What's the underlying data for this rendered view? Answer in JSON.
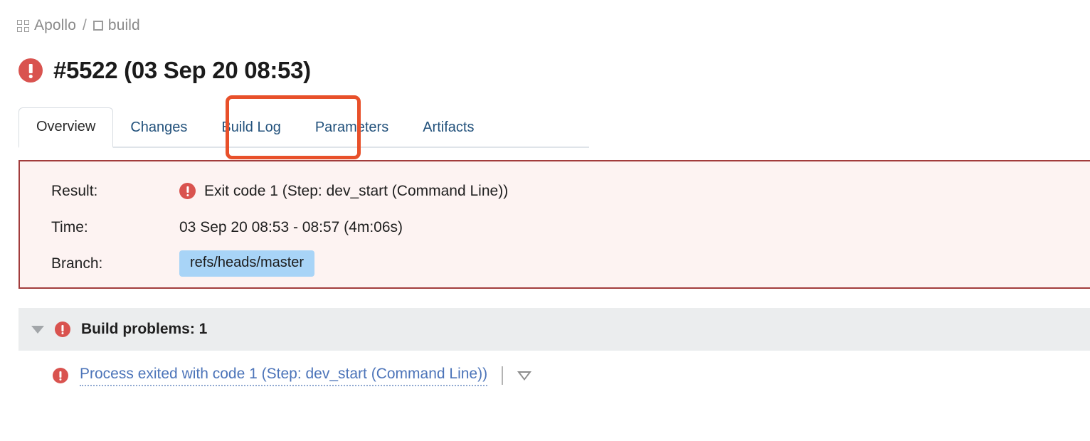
{
  "breadcrumb": {
    "project_icon": "grid-icon",
    "project": "Apollo",
    "separator": "/",
    "build_icon": "square-icon",
    "build": "build"
  },
  "title": {
    "status_icon": "error-icon",
    "text": "#5522 (03 Sep 20 08:53)"
  },
  "tabs": [
    {
      "label": "Overview",
      "active": true
    },
    {
      "label": "Changes",
      "active": false
    },
    {
      "label": "Build Log",
      "active": false
    },
    {
      "label": "Parameters",
      "active": false
    },
    {
      "label": "Artifacts",
      "active": false
    }
  ],
  "annotation": {
    "target": "Build Log",
    "color": "#e8502a"
  },
  "result_panel": {
    "rows": [
      {
        "label": "Result:",
        "icon": "error-icon",
        "value": "Exit code 1 (Step: dev_start (Command Line))"
      },
      {
        "label": "Time:",
        "icon": null,
        "value": "03 Sep 20 08:53 - 08:57 (4m:06s)"
      },
      {
        "label": "Branch:",
        "icon": null,
        "value": "refs/heads/master",
        "badge": true
      }
    ],
    "border_color": "#a23c3c",
    "background_color": "#fdf3f2",
    "badge_color": "#a8d4f7"
  },
  "build_problems": {
    "toggle_icon": "caret-down-icon",
    "status_icon": "error-icon",
    "header": "Build problems: 1",
    "items": [
      {
        "icon": "error-icon",
        "link": "Process exited with code 1 (Step: dev_start (Command Line))",
        "menu_icon": "triangle-down-icon"
      }
    ],
    "header_background": "#ebedee"
  },
  "colors": {
    "error": "#d9534f",
    "link": "#4c74b9",
    "tab_link": "#23527c",
    "annotation": "#e8502a"
  }
}
